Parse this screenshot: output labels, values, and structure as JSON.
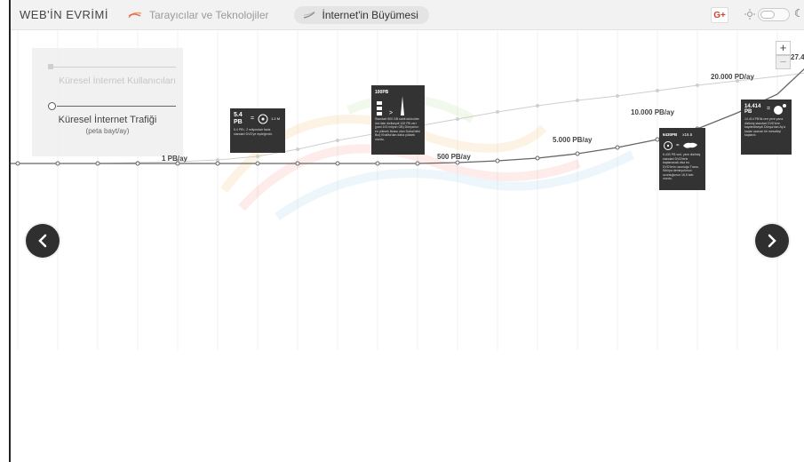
{
  "header": {
    "brand": "WEB'İN EVRİMİ",
    "nav": [
      {
        "label": "Tarayıcılar ve Teknolojiler"
      },
      {
        "label": "İnternet'in Büyümesi"
      }
    ],
    "gplus": "G+"
  },
  "legend": {
    "users_label": "Küresel İnternet Kullanıcıları",
    "traffic_label": "Küresel İnternet Trafiği",
    "traffic_unit": "(peta bayt/ay)"
  },
  "zoom": {
    "in": "+",
    "out": "−"
  },
  "traffic_labels": {
    "l1": "1 PB/ay",
    "l500": "500 PB/ay",
    "l5000": "5.000 PB/ay",
    "l10000": "10.000 PB/ay",
    "l20000": "20.000 PD/ay",
    "edge": "27.4"
  },
  "cards": {
    "c1": {
      "big": "5.4 PB",
      "eq": "=",
      "small": "1.2 M",
      "note": "5.4 PB'ı, 2 milyondan fazla standart DVD'ye eşdeğerdir."
    },
    "c2": {
      "big": "100PB",
      "note": "Standart 500 GB sabit sürücüler üst üste dizilseydi 100 PB veri (yani 100 milyon GB) Dünya'nın en yüksek binası olan Dubai'deki Burj Khalifa'dan daha yüksek olurdu."
    },
    "c3": {
      "big": "6430PB",
      "eq": "=",
      "small": "x16.5",
      "note": "6.430 PB veri, yere dizilmiş standart DVD'lerle kaplanacak olsa bu DVD'lerin uzunluğu Trans-Sibirya demiryolunun uzunluğunun 16,5 katı olurdu."
    },
    "c4": {
      "big": "14.414 PB",
      "eq": "=",
      "note": "14.414 PB'lik veri yere yana dizilmiş standart DVD'lere kaydedilseydi Dünya'dan Ay'a kadar uzanan bir mesafeyi kaplardı."
    }
  },
  "colors": {
    "accent": "#333333",
    "topbar": "#f2f2f2"
  }
}
